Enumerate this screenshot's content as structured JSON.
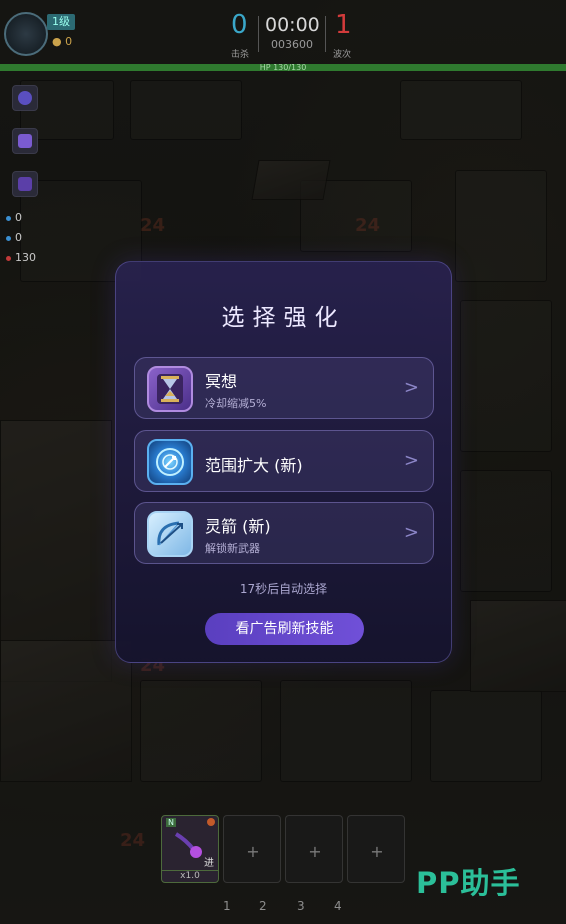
{
  "hud": {
    "level": "1级",
    "coins": "0",
    "kills": "0",
    "kills_label": "击杀",
    "timer": "00:00",
    "score": "003600",
    "wave": "1",
    "wave_label": "波次",
    "hp_text": "HP 130/130",
    "colors": {
      "kills": "#3aa7c9",
      "wave": "#d23b3b",
      "hp": "#2f7a2f"
    }
  },
  "resources": [
    {
      "value": "0",
      "color": "#3b8fd1"
    },
    {
      "value": "0",
      "color": "#3b8fd1"
    },
    {
      "value": "130",
      "color": "#c23a3a"
    }
  ],
  "dialog": {
    "title": "选择强化",
    "options": [
      {
        "name": "冥想",
        "desc": "冷却缩减5%",
        "icon": "hourglass-icon"
      },
      {
        "name": "范围扩大 (新)",
        "desc": "",
        "icon": "range-orb-icon"
      },
      {
        "name": "灵箭 (新)",
        "desc": "解锁新武器",
        "icon": "bow-icon"
      }
    ],
    "countdown": "17秒后自动选择",
    "ad_button": "看广告刷新技能"
  },
  "bottom": {
    "slot1_tag": "N",
    "slot1_badge": "进",
    "slot1_mult": "x1.0",
    "plus": "+",
    "tabs": [
      "1",
      "2",
      "3",
      "4"
    ]
  },
  "watermark": "PP助手"
}
